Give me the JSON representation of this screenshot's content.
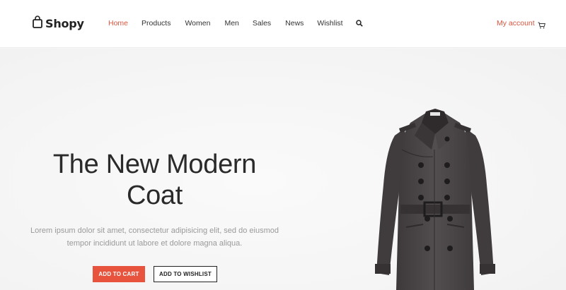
{
  "brand": {
    "name": "Shopy"
  },
  "nav": {
    "items": [
      {
        "label": "Home",
        "active": true
      },
      {
        "label": "Products",
        "active": false
      },
      {
        "label": "Women",
        "active": false
      },
      {
        "label": "Men",
        "active": false
      },
      {
        "label": "Sales",
        "active": false
      },
      {
        "label": "News",
        "active": false
      },
      {
        "label": "Wishlist",
        "active": false
      }
    ],
    "search_icon": "search-icon"
  },
  "account": {
    "label": "My account",
    "cart_icon": "cart-icon"
  },
  "hero": {
    "title_line1": "The New Modern",
    "title_line2": "Coat",
    "desc_line1": "Lorem ipsum dolor sit amet, consectetur adipisicing elit, sed do eiusmod",
    "desc_line2": "tempor incididunt ut labore et dolore magna aliqua.",
    "add_to_cart": "ADD TO CART",
    "add_to_wishlist": "ADD TO WISHLIST"
  },
  "colors": {
    "accent": "#e8533d",
    "active_link": "#d9553f",
    "text": "#333333",
    "muted": "#9a9a9a",
    "background": "#f7f7f7",
    "coat": "#4a4647"
  }
}
